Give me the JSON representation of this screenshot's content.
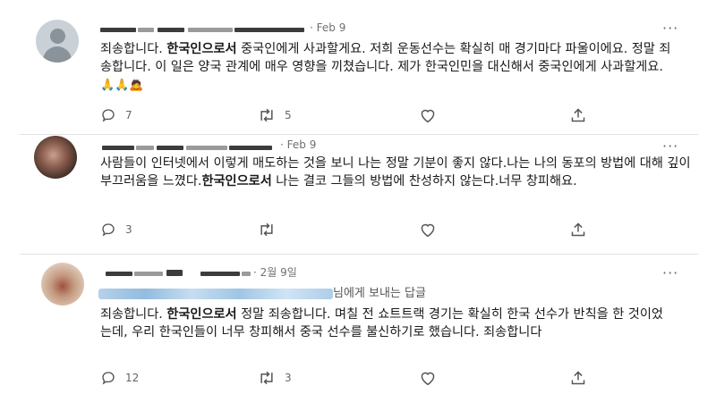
{
  "posts": [
    {
      "date": "Feb 9",
      "text_before_bold": "죄송합니다. ",
      "bold": "한국인으로서",
      "text_after_bold": " 중국인에게 사과할게요. 저희 운동선수는 확실히 매 경기마다 파울이에요. 정말 죄송합니다. 이 일은 양국 관계에 매우 영향을 끼쳤습니다. 제가 한국인민을 대신해서 중국인에게 사과할게요. ",
      "emojis": "🙏🙏🙇",
      "replies": "7",
      "retweets": "5",
      "likes": "",
      "avatar_icon": "default-profile-icon"
    },
    {
      "date": "Feb 9",
      "text_before_bold": "사람들이 인터넷에서 이렇게 매도하는 것을 보니 나는 정말 기분이 좋지 않다.나는 나의 동포의 방법에 대해 깊이 부끄러움을 느꼈다.",
      "bold": "한국인으로서",
      "text_after_bold": " 나는 결코 그들의 방법에 찬성하지 않는다.너무 창피해요.",
      "replies": "3",
      "retweets": "",
      "likes": "",
      "avatar_icon": "profile-photo"
    },
    {
      "date": "2월 9일",
      "reply_to_suffix": "님에게 보내는 답글",
      "text_before_bold": "죄송합니다. ",
      "bold": "한국인으로서",
      "text_after_bold": " 정말 죄송합니다. 며칠 전 쇼트트랙 경기는 확실히 한국 선수가 반칙을 한 것이었는데, 우리 한국인들이 너무 창피해서 중국 선수를 불신하기로 했습니다. 죄송합니다",
      "replies": "12",
      "retweets": "3",
      "likes": "",
      "avatar_icon": "profile-photo"
    }
  ],
  "icons": [
    "reply-icon",
    "retweet-icon",
    "like-icon",
    "share-icon",
    "more-icon"
  ],
  "more_glyph": "···"
}
